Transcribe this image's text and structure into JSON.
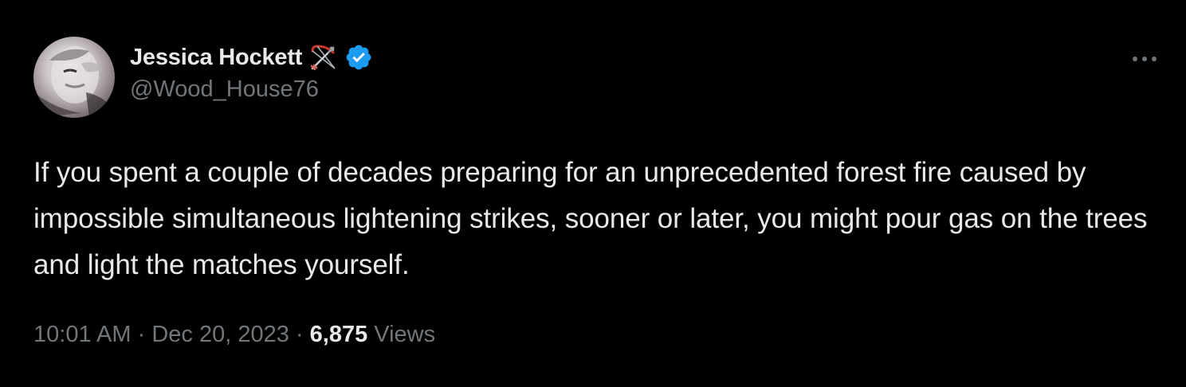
{
  "author": {
    "display_name": "Jessica Hockett",
    "handle": "@Wood_House76",
    "name_emoji": "bow-and-arrow-icon",
    "verified": true,
    "verified_color": "#1d9bf0"
  },
  "tweet": {
    "text": "If you spent a couple of decades preparing for an unprecedented forest fire caused by impossible simultaneous lightening strikes, sooner or later, you might pour gas on the trees and light the matches yourself.",
    "time": "10:01 AM",
    "separator": "·",
    "date": "Dec 20, 2023",
    "views_count": "6,875",
    "views_label": "Views"
  },
  "icons": {
    "more": "more-options-icon"
  },
  "colors": {
    "background": "#000000",
    "text_primary": "#e7e9ea",
    "text_secondary": "#71767b"
  }
}
